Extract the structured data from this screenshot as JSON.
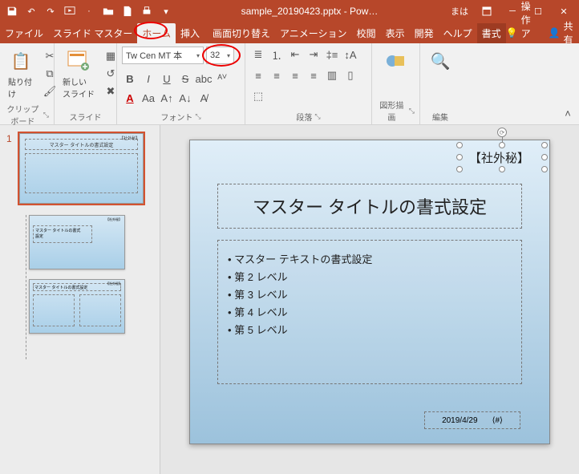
{
  "titlebar": {
    "filename": "sample_20190423.pptx - Pow…",
    "username": "まは"
  },
  "menu": {
    "items": [
      "ファイル",
      "スライド マスター",
      "ホーム",
      "挿入",
      "画面切り替え",
      "アニメーション",
      "校閲",
      "表示",
      "開発",
      "ヘルプ",
      "書式"
    ],
    "active_index": 2,
    "tell_label": "操作アシス",
    "share_label": "共有"
  },
  "ribbon": {
    "clipboard": {
      "label": "クリップボード",
      "paste": "貼り付け"
    },
    "slides": {
      "label": "スライド",
      "new_slide": "新しい\nスライド"
    },
    "font": {
      "label": "フォント",
      "family": "Tw Cen MT 本",
      "size": "32",
      "bold": "B",
      "italic": "I",
      "underline": "U",
      "strike": "S",
      "aa": "Aa",
      "av": "ᴬⱽ"
    },
    "paragraph": {
      "label": "段落"
    },
    "drawing": {
      "label": "図形描画"
    },
    "editing": {
      "label": "編集"
    }
  },
  "thumbs": {
    "number": "1",
    "master_title": "マスター タイトルの書式設定",
    "layout1_title": "マスター タイトルの書式\n設定",
    "layout2_title": "マスター タイトルの書式設定"
  },
  "slide": {
    "confidential": "【社外秘】",
    "title": "マスター タイトルの書式設定",
    "body": {
      "lv1": "マスター テキストの書式設定",
      "lv2": "第 2 レベル",
      "lv3": "第 3 レベル",
      "lv4": "第 4 レベル",
      "lv5": "第 5 レベル"
    },
    "date": "2019/4/29",
    "footer_icon": "⟨#⟩"
  }
}
